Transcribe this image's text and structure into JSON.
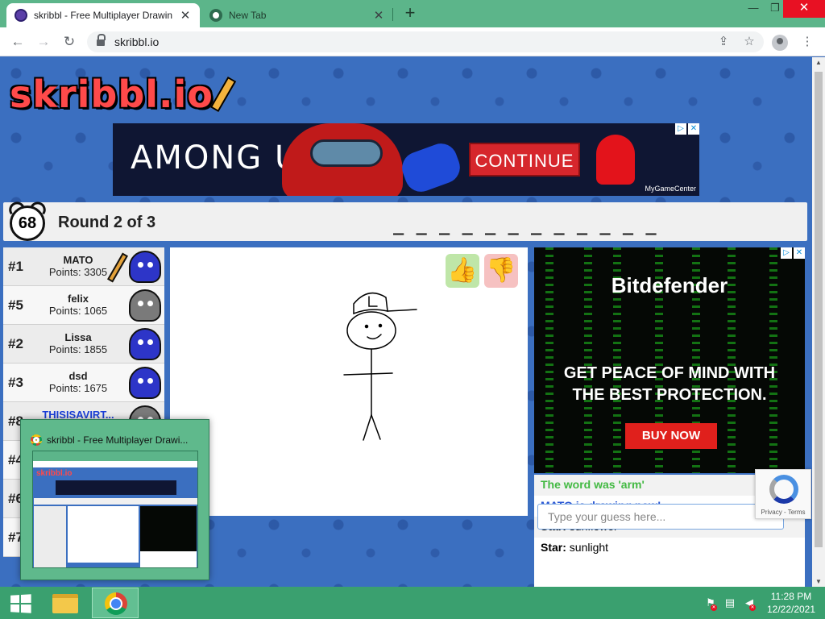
{
  "browser": {
    "tabs": [
      {
        "title": "skribbl - Free Multiplayer Drawin",
        "active": true
      },
      {
        "title": "New Tab",
        "active": false
      }
    ],
    "new_tab_glyph": "+",
    "window_controls": {
      "minimize": "—",
      "maximize": "❐",
      "close": "✕"
    },
    "url": "skribbl.io",
    "icons": [
      "back-icon",
      "forward-icon",
      "reload-icon",
      "lock-icon",
      "share-icon",
      "star-icon",
      "profile-icon",
      "menu-icon"
    ]
  },
  "game": {
    "logo": "skribbl.io",
    "timer": "68",
    "round": "Round 2 of 3",
    "word_hint": "_ _ _ _ _ _ _ _ _ _ _ _",
    "players": [
      {
        "rank": "#1",
        "name": "MATO",
        "points": "Points: 3305",
        "drawing": true,
        "avatar_color": "#2d35c8"
      },
      {
        "rank": "#5",
        "name": "felix",
        "points": "Points: 1065",
        "drawing": false,
        "avatar_color": "#7a7a7a"
      },
      {
        "rank": "#2",
        "name": "Lissa",
        "points": "Points: 1855",
        "drawing": false,
        "avatar_color": "#2d35c8"
      },
      {
        "rank": "#3",
        "name": "dsd",
        "points": "Points: 1675",
        "drawing": false,
        "avatar_color": "#2d35c8"
      },
      {
        "rank": "#8",
        "name": "THISISAVIRT...",
        "points": "",
        "drawing": false,
        "self": true,
        "avatar_color": "#7a7a7a"
      },
      {
        "rank": "#4",
        "name": "",
        "points": "",
        "drawing": false,
        "avatar_color": "#2d35c8"
      },
      {
        "rank": "#6",
        "name": "",
        "points": "",
        "drawing": false,
        "avatar_color": "#2d35c8"
      },
      {
        "rank": "#7",
        "name": "",
        "points": "",
        "drawing": false,
        "avatar_color": "#2d35c8"
      }
    ],
    "rate": {
      "like": "👍",
      "dislike": "👎"
    },
    "chat": [
      {
        "text": "The word was 'arm'",
        "style": "green"
      },
      {
        "text": "MATO is drawing now!",
        "style": "blue"
      },
      {
        "user": "Star:",
        "text": "sunflower",
        "style": "normal"
      },
      {
        "user": "Star:",
        "text": "sunlight",
        "style": "normal"
      }
    ],
    "chat_scroll_glyph": "▲",
    "guess_placeholder": "Type your guess here..."
  },
  "ads": {
    "banner": {
      "headline": "AMONG US",
      "cta": "CONTINUE",
      "sponsor": "MyGameCenter"
    },
    "side": {
      "brand": "Bitdefender",
      "headline": "GET PEACE OF MIND WITH THE BEST PROTECTION.",
      "cta": "BUY NOW"
    },
    "adchoices_glyphs": [
      "▷",
      "✕"
    ]
  },
  "recaptcha": {
    "terms": "Privacy - Terms"
  },
  "preview": {
    "title": "skribbl - Free Multiplayer Drawi...",
    "thumb_logo": "skribbl.io"
  },
  "taskbar": {
    "apps": [
      "windows-start",
      "file-explorer",
      "google-chrome"
    ],
    "time": "11:28 PM",
    "date": "12/22/2021"
  },
  "colors": {
    "page_blue": "#3b6fc0",
    "accent_green": "#5cb58a",
    "chat_green": "#42b942",
    "chat_blue": "#2c58d4",
    "self_name": "#1a3fd8"
  }
}
